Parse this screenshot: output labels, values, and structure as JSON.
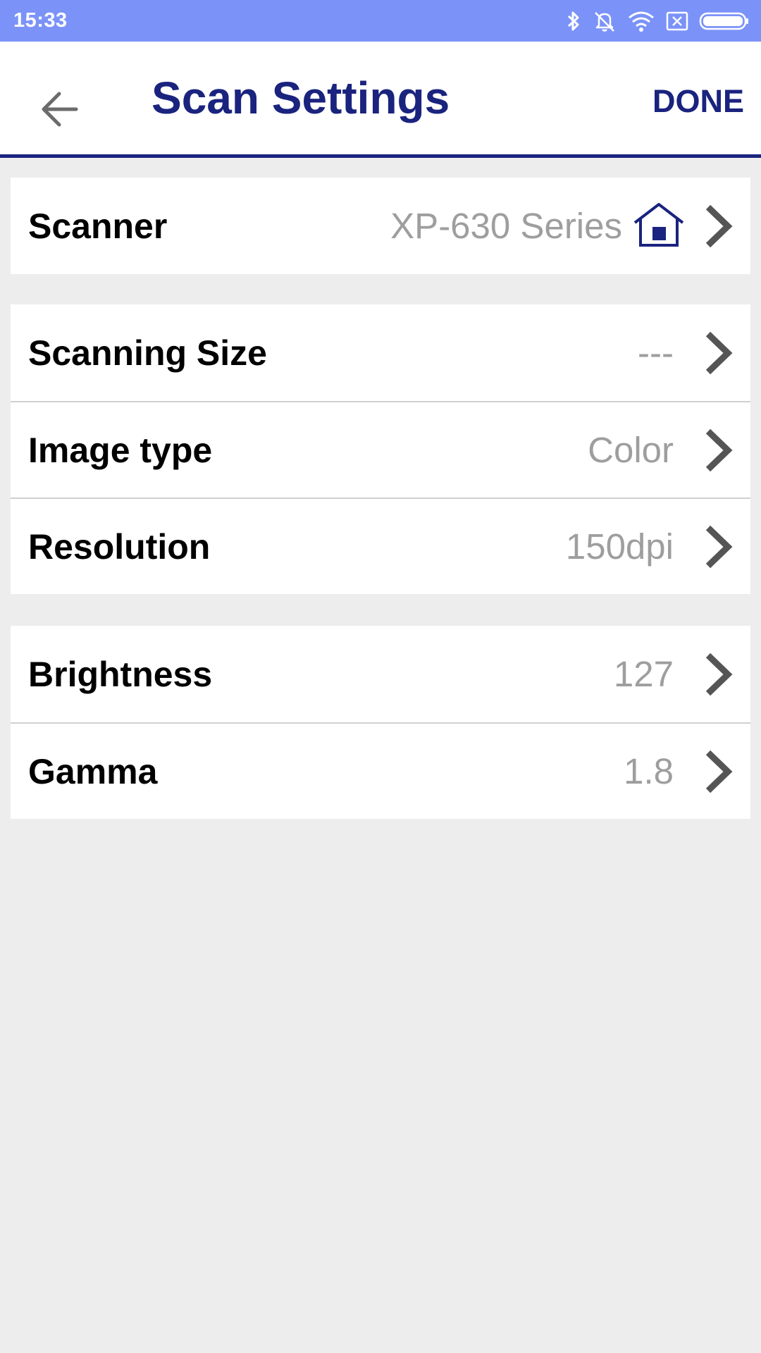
{
  "status_bar": {
    "time": "15:33",
    "icons": [
      "bluetooth-icon",
      "mute-icon",
      "wifi-icon",
      "no-sim-icon",
      "battery-icon"
    ]
  },
  "header": {
    "back_icon": "arrow-left-icon",
    "title": "Scan Settings",
    "done_label": "DONE"
  },
  "groups": [
    {
      "rows": [
        {
          "label": "Scanner",
          "value": "XP-630 Series",
          "icon": "home-icon"
        }
      ]
    },
    {
      "rows": [
        {
          "label": "Scanning Size",
          "value": "---"
        },
        {
          "label": "Image type",
          "value": "Color"
        },
        {
          "label": "Resolution",
          "value": "150dpi"
        }
      ]
    },
    {
      "rows": [
        {
          "label": "Brightness",
          "value": "127"
        },
        {
          "label": "Gamma",
          "value": "1.8"
        }
      ]
    }
  ],
  "colors": {
    "status_bar": "#7b93f8",
    "accent": "#1a237e",
    "background": "#ededed",
    "value_text": "#9e9e9e",
    "chevron": "#555555"
  }
}
